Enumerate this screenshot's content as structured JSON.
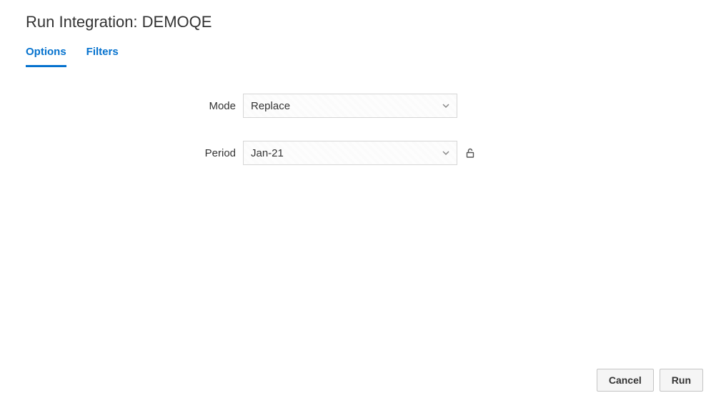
{
  "header": {
    "title": "Run Integration: DEMOQE"
  },
  "tabs": {
    "options": "Options",
    "filters": "Filters",
    "active": "options"
  },
  "form": {
    "mode": {
      "label": "Mode",
      "value": "Replace"
    },
    "period": {
      "label": "Period",
      "value": "Jan-21"
    }
  },
  "footer": {
    "cancel": "Cancel",
    "run": "Run"
  }
}
